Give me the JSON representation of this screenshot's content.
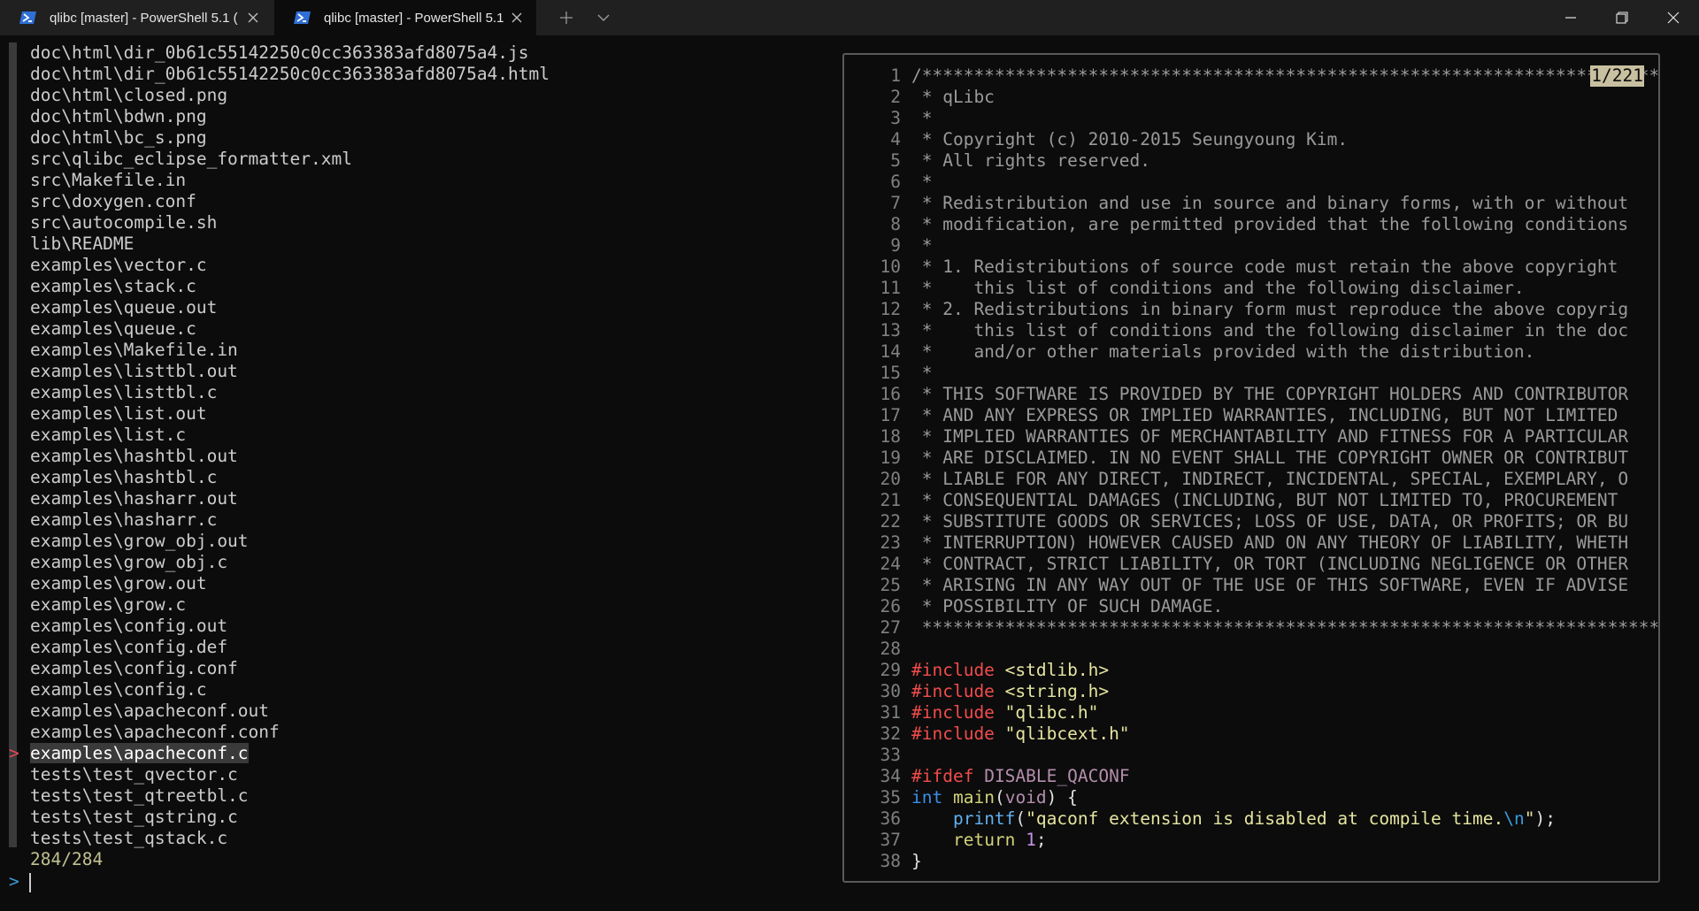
{
  "tabs": [
    {
      "title": "qlibc [master] - PowerShell 5.1 (",
      "icon": "powershell-icon",
      "active": false
    },
    {
      "title": "qlibc [master] - PowerShell 5.1 (",
      "icon": "powershell-icon",
      "active": true
    }
  ],
  "window_controls": {
    "new_tab": "+",
    "dropdown": "chevron-down-icon"
  },
  "files": [
    "doc\\html\\dir_0b61c55142250c0cc363383afd8075a4.js",
    "doc\\html\\dir_0b61c55142250c0cc363383afd8075a4.html",
    "doc\\html\\closed.png",
    "doc\\html\\bdwn.png",
    "doc\\html\\bc_s.png",
    "src\\qlibc_eclipse_formatter.xml",
    "src\\Makefile.in",
    "src\\doxygen.conf",
    "src\\autocompile.sh",
    "lib\\README",
    "examples\\vector.c",
    "examples\\stack.c",
    "examples\\queue.out",
    "examples\\queue.c",
    "examples\\Makefile.in",
    "examples\\listtbl.out",
    "examples\\listtbl.c",
    "examples\\list.out",
    "examples\\list.c",
    "examples\\hashtbl.out",
    "examples\\hashtbl.c",
    "examples\\hasharr.out",
    "examples\\hasharr.c",
    "examples\\grow_obj.out",
    "examples\\grow_obj.c",
    "examples\\grow.out",
    "examples\\grow.c",
    "examples\\config.out",
    "examples\\config.def",
    "examples\\config.conf",
    "examples\\config.c",
    "examples\\apacheconf.out",
    "examples\\apacheconf.conf",
    "examples\\apacheconf.c",
    "tests\\test_qvector.c",
    "tests\\test_qtreetbl.c",
    "tests\\test_qstring.c",
    "tests\\test_qstack.c"
  ],
  "selected_index": 33,
  "pointer": ">",
  "match_count": "284/284",
  "prompt": ">",
  "preview": {
    "position": "1/221",
    "lines": [
      {
        "n": "1",
        "text": "/*************************************************************************"
      },
      {
        "n": "2",
        "text": " * qLibc"
      },
      {
        "n": "3",
        "text": " *"
      },
      {
        "n": "4",
        "text": " * Copyright (c) 2010-2015 Seungyoung Kim."
      },
      {
        "n": "5",
        "text": " * All rights reserved."
      },
      {
        "n": "6",
        "text": " *"
      },
      {
        "n": "7",
        "text": " * Redistribution and use in source and binary forms, with or without"
      },
      {
        "n": "8",
        "text": " * modification, are permitted provided that the following conditions"
      },
      {
        "n": "9",
        "text": " *"
      },
      {
        "n": "10",
        "text": " * 1. Redistributions of source code must retain the above copyright"
      },
      {
        "n": "11",
        "text": " *    this list of conditions and the following disclaimer."
      },
      {
        "n": "12",
        "text": " * 2. Redistributions in binary form must reproduce the above copyrig"
      },
      {
        "n": "13",
        "text": " *    this list of conditions and the following disclaimer in the doc"
      },
      {
        "n": "14",
        "text": " *    and/or other materials provided with the distribution."
      },
      {
        "n": "15",
        "text": " *"
      },
      {
        "n": "16",
        "text": " * THIS SOFTWARE IS PROVIDED BY THE COPYRIGHT HOLDERS AND CONTRIBUTOR"
      },
      {
        "n": "17",
        "text": " * AND ANY EXPRESS OR IMPLIED WARRANTIES, INCLUDING, BUT NOT LIMITED"
      },
      {
        "n": "18",
        "text": " * IMPLIED WARRANTIES OF MERCHANTABILITY AND FITNESS FOR A PARTICULAR"
      },
      {
        "n": "19",
        "text": " * ARE DISCLAIMED. IN NO EVENT SHALL THE COPYRIGHT OWNER OR CONTRIBUT"
      },
      {
        "n": "20",
        "text": " * LIABLE FOR ANY DIRECT, INDIRECT, INCIDENTAL, SPECIAL, EXEMPLARY, O"
      },
      {
        "n": "21",
        "text": " * CONSEQUENTIAL DAMAGES (INCLUDING, BUT NOT LIMITED TO, PROCUREMENT"
      },
      {
        "n": "22",
        "text": " * SUBSTITUTE GOODS OR SERVICES; LOSS OF USE, DATA, OR PROFITS; OR BU"
      },
      {
        "n": "23",
        "text": " * INTERRUPTION) HOWEVER CAUSED AND ON ANY THEORY OF LIABILITY, WHETH"
      },
      {
        "n": "24",
        "text": " * CONTRACT, STRICT LIABILITY, OR TORT (INCLUDING NEGLIGENCE OR OTHER"
      },
      {
        "n": "25",
        "text": " * ARISING IN ANY WAY OUT OF THE USE OF THIS SOFTWARE, EVEN IF ADVISE"
      },
      {
        "n": "26",
        "text": " * POSSIBILITY OF SUCH DAMAGE."
      },
      {
        "n": "27",
        "text": " *************************************************************************"
      },
      {
        "n": "28",
        "text": ""
      },
      {
        "n": "29",
        "text": "#include <stdlib.h>"
      },
      {
        "n": "30",
        "text": "#include <string.h>"
      },
      {
        "n": "31",
        "text": "#include \"qlibc.h\""
      },
      {
        "n": "32",
        "text": "#include \"qlibcext.h\""
      },
      {
        "n": "33",
        "text": ""
      },
      {
        "n": "34",
        "text": "#ifdef DISABLE_QACONF"
      },
      {
        "n": "35",
        "text": "int main(void) {"
      },
      {
        "n": "36",
        "text": "    printf(\"qaconf extension is disabled at compile time.\\n\");"
      },
      {
        "n": "37",
        "text": "    return 1;"
      },
      {
        "n": "38",
        "text": "}"
      }
    ]
  },
  "colors": {
    "background": "#0c0c0c",
    "titlebar": "#202020",
    "pointer": "#e74856",
    "prompt": "#3b9bdc",
    "count": "#c0c090",
    "badge": "#c8c0a0"
  }
}
